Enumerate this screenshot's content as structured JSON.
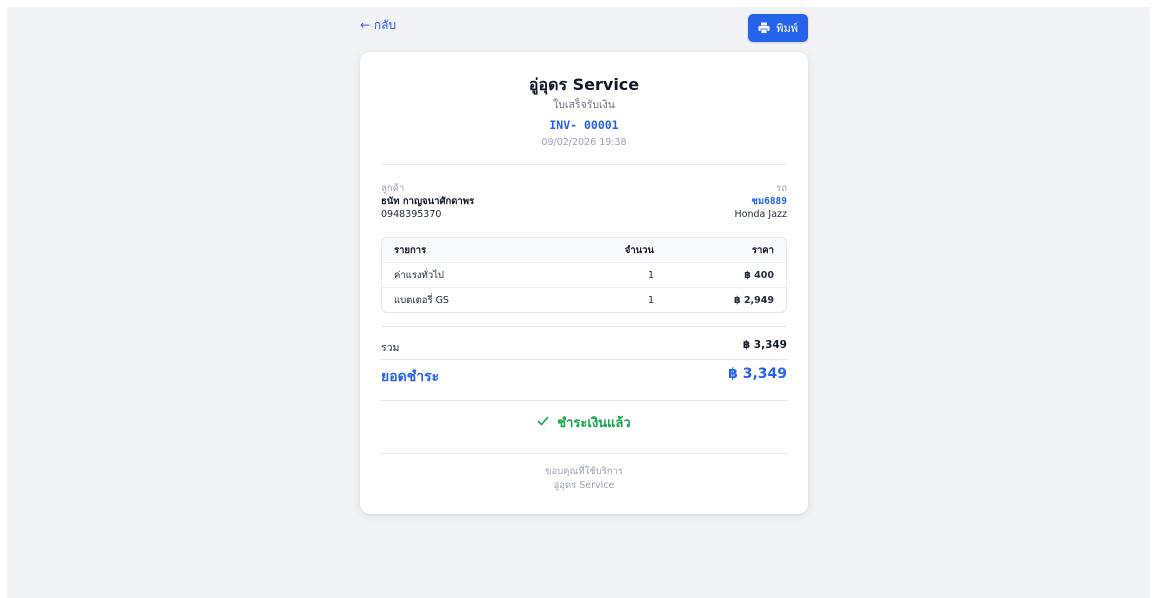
{
  "nav": {
    "back_label": "← กลับ",
    "print_label": "พิมพ์"
  },
  "receipt": {
    "shop_name": "อู่อุดร Service",
    "doc_type": "ใบเสร็จรับเงิน",
    "invoice_no": "INV- 00001",
    "datetime": "09/02/2026 19:38",
    "customer": {
      "label": "ลูกค้า",
      "name": "ธนัท กาญจนาศักดาพร",
      "phone": "0948395370"
    },
    "vehicle": {
      "label": "รถ",
      "plate": "ชม6889",
      "model": "Honda Jazz"
    },
    "table": {
      "headers": {
        "item": "รายการ",
        "qty": "จำนวน",
        "price": "ราคา"
      },
      "rows": [
        {
          "item": "ค่าแรงทั่วไป",
          "qty": "1",
          "price": "฿ 400"
        },
        {
          "item": "แบตเตอรี่ GS",
          "qty": "1",
          "price": "฿ 2,949"
        }
      ]
    },
    "subtotal_label": "รวม",
    "subtotal_value": "฿ 3,349",
    "total_label": "ยอดชำระ",
    "total_value": "฿ 3,349",
    "status": "ชำระเงินแล้ว",
    "thanks": "ขอบคุณที่ใช้บริการ",
    "footer_shop": "อู่อุดร Service"
  },
  "colors": {
    "accent": "#2563eb",
    "success": "#16a34a",
    "background": "#f1f3f6"
  },
  "icons": {
    "print": "printer-icon",
    "status": "check-icon"
  }
}
